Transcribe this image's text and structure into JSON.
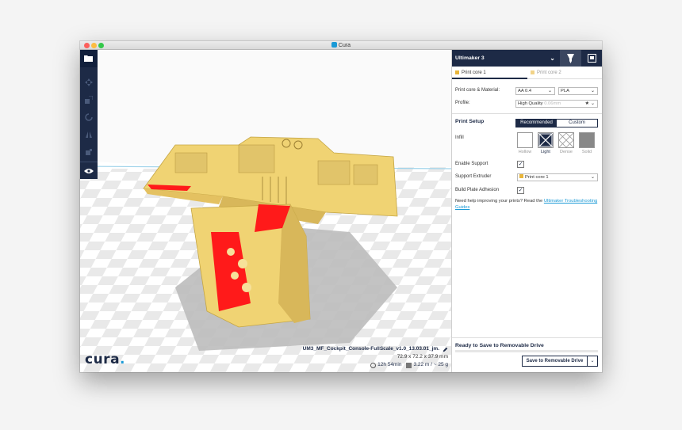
{
  "window": {
    "title": "Cura"
  },
  "toolbar": {
    "tools": [
      "open-file-icon",
      "move-icon",
      "scale-icon",
      "rotate-icon",
      "mirror-icon",
      "per-model-settings-icon"
    ],
    "view_icon": "eye-icon"
  },
  "viewport": {
    "logo_text": "cura",
    "logo_dot": ".",
    "job_name": "UM3_MF_Cockpit_Console-FullScale_v1.0_13.03.01_jm.",
    "dimensions": "72.9 x 72.2 x 37.9 mm",
    "print_time": "12h 54min",
    "material_usage": "3.22 m / ~ 25 g"
  },
  "panel": {
    "printer_name": "Ultimaker 3",
    "core_tabs": [
      {
        "label": "Print core 1",
        "color": "#e8b53a"
      },
      {
        "label": "Print core 2",
        "color": "#e8b53a"
      }
    ],
    "core_material_label": "Print core & Material:",
    "core_value": "AA 0.4",
    "material_value": "PLA",
    "profile_label": "Profile:",
    "profile_value": "High Quality",
    "profile_hint": "0.06mm",
    "print_setup_title": "Print Setup",
    "mode_recommended": "Recommended",
    "mode_custom": "Custom",
    "infill_label": "Infill",
    "infill_options": [
      "Hollow",
      "Light",
      "Dense",
      "Solid"
    ],
    "infill_selected": "Light",
    "enable_support_label": "Enable Support",
    "support_extruder_label": "Support Extruder",
    "support_extruder_value": "Print core 1",
    "build_plate_adhesion_label": "Build Plate Adhesion",
    "help_text": "Need help improving your prints? Read the",
    "help_link": "Ultimaker Troubleshooting Guides",
    "ready_text": "Ready to Save to Removable Drive",
    "save_button": "Save to Removable Drive"
  },
  "colors": {
    "dark_navy": "#1d2a46",
    "accent_blue": "#1b9ad6",
    "model_yellow": "#f0d373",
    "overhang_red": "#ff1a1a"
  }
}
